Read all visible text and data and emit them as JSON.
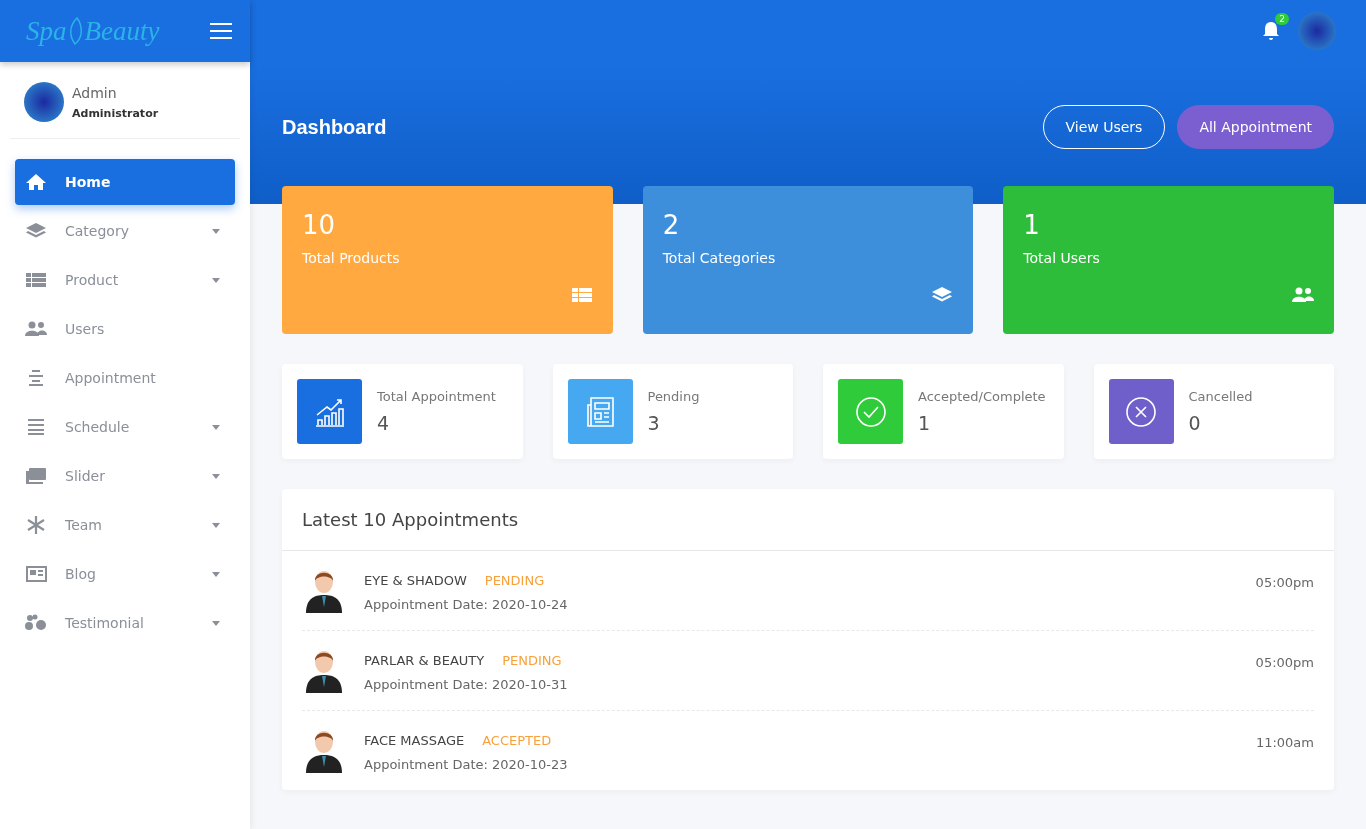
{
  "brand": {
    "word_1": "Spa",
    "word_2": "Beauty"
  },
  "topbar": {
    "notification_count": "2"
  },
  "profile": {
    "name": "Admin",
    "role": "Administrator"
  },
  "sidebar": {
    "items": [
      {
        "label": "Home",
        "selected": true,
        "has_submenu": false
      },
      {
        "label": "Category",
        "selected": false,
        "has_submenu": true
      },
      {
        "label": "Product",
        "selected": false,
        "has_submenu": true
      },
      {
        "label": "Users",
        "selected": false,
        "has_submenu": false
      },
      {
        "label": "Appointment",
        "selected": false,
        "has_submenu": false
      },
      {
        "label": "Schedule",
        "selected": false,
        "has_submenu": true
      },
      {
        "label": "Slider",
        "selected": false,
        "has_submenu": true
      },
      {
        "label": "Team",
        "selected": false,
        "has_submenu": true
      },
      {
        "label": "Blog",
        "selected": false,
        "has_submenu": true
      },
      {
        "label": "Testimonial",
        "selected": false,
        "has_submenu": true
      }
    ]
  },
  "page": {
    "title": "Dashboard",
    "buttons": [
      {
        "label": "View Users",
        "kind": "outline"
      },
      {
        "label": "All Appointment",
        "kind": "filled"
      }
    ]
  },
  "stat_cards": [
    {
      "value": "10",
      "label": "Total Products",
      "color": "#ffa940"
    },
    {
      "value": "2",
      "label": "Total Categories",
      "color": "#3d8fdc"
    },
    {
      "value": "1",
      "label": "Total Users",
      "color": "#2ebd3a"
    }
  ],
  "appointment_stats": [
    {
      "label": "Total Appointment",
      "value": "4",
      "color": "#1a6fe0"
    },
    {
      "label": "Pending",
      "value": "3",
      "color": "#45a8f0"
    },
    {
      "label": "Accepted/Complete",
      "value": "1",
      "color": "#2fcb3a"
    },
    {
      "label": "Cancelled",
      "value": "0",
      "color": "#6f5fcb"
    }
  ],
  "latest": {
    "title": "Latest 10 Appointments",
    "rows": [
      {
        "service": "EYE & SHADOW",
        "status": "PENDING",
        "date": "Appointment Date: 2020-10-24",
        "time": "05:00pm"
      },
      {
        "service": "PARLAR & BEAUTY",
        "status": "PENDING",
        "date": "Appointment Date: 2020-10-31",
        "time": "05:00pm"
      },
      {
        "service": "FACE MASSAGE",
        "status": "ACCEPTED",
        "date": "Appointment Date: 2020-10-23",
        "time": "11:00am"
      }
    ]
  }
}
